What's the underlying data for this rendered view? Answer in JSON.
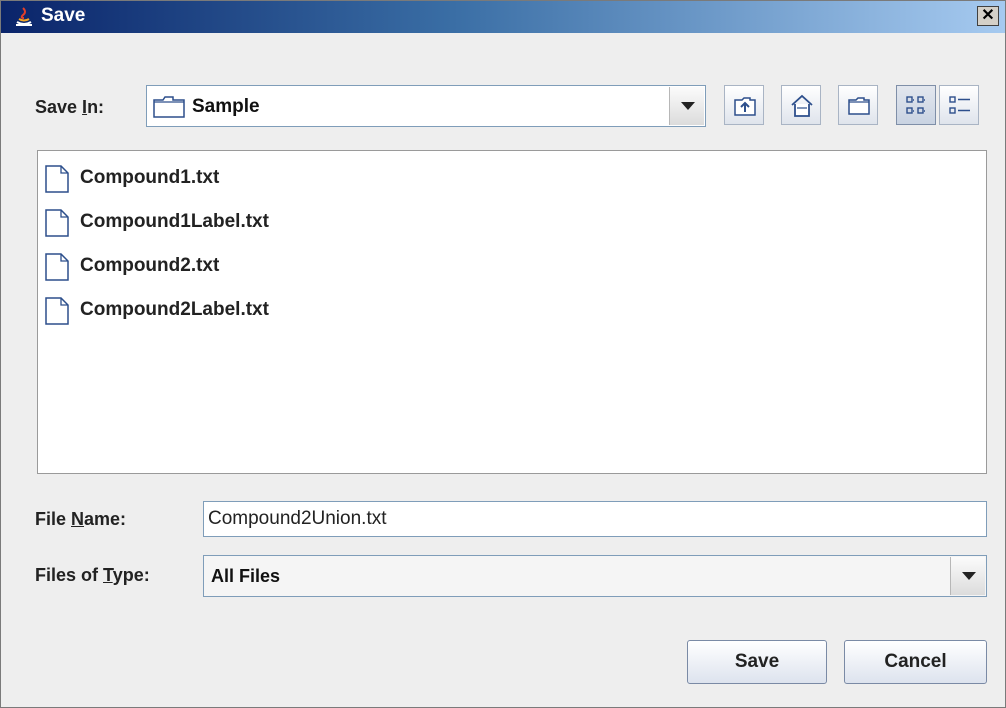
{
  "window": {
    "title": "Save",
    "close_glyph": "✕"
  },
  "save_in": {
    "label_pre": "Save ",
    "label_mnemonic": "I",
    "label_post": "n:",
    "value": "Sample",
    "icon": "folder-icon"
  },
  "toolbar": {
    "buttons": [
      {
        "name": "up-one-level",
        "icon": "up-folder-icon"
      },
      {
        "name": "home",
        "icon": "home-icon"
      },
      {
        "name": "new-folder",
        "icon": "new-folder-icon"
      },
      {
        "name": "list-view",
        "icon": "list-view-icon"
      },
      {
        "name": "details-view",
        "icon": "details-view-icon"
      }
    ]
  },
  "files": [
    {
      "name": "Compound1.txt",
      "icon": "file-icon"
    },
    {
      "name": "Compound1Label.txt",
      "icon": "file-icon"
    },
    {
      "name": "Compound2.txt",
      "icon": "file-icon"
    },
    {
      "name": "Compound2Label.txt",
      "icon": "file-icon"
    }
  ],
  "file_name": {
    "label_pre": "File ",
    "label_mnemonic": "N",
    "label_post": "ame:",
    "value": "Compound2Union.txt"
  },
  "file_type": {
    "label_pre": "Files of ",
    "label_mnemonic": "T",
    "label_post": "ype:",
    "value": "All Files"
  },
  "buttons": {
    "save": "Save",
    "cancel": "Cancel"
  },
  "colors": {
    "titlebar_start": "#0a246a",
    "titlebar_end": "#a6caf0",
    "background": "#eeeeee"
  }
}
